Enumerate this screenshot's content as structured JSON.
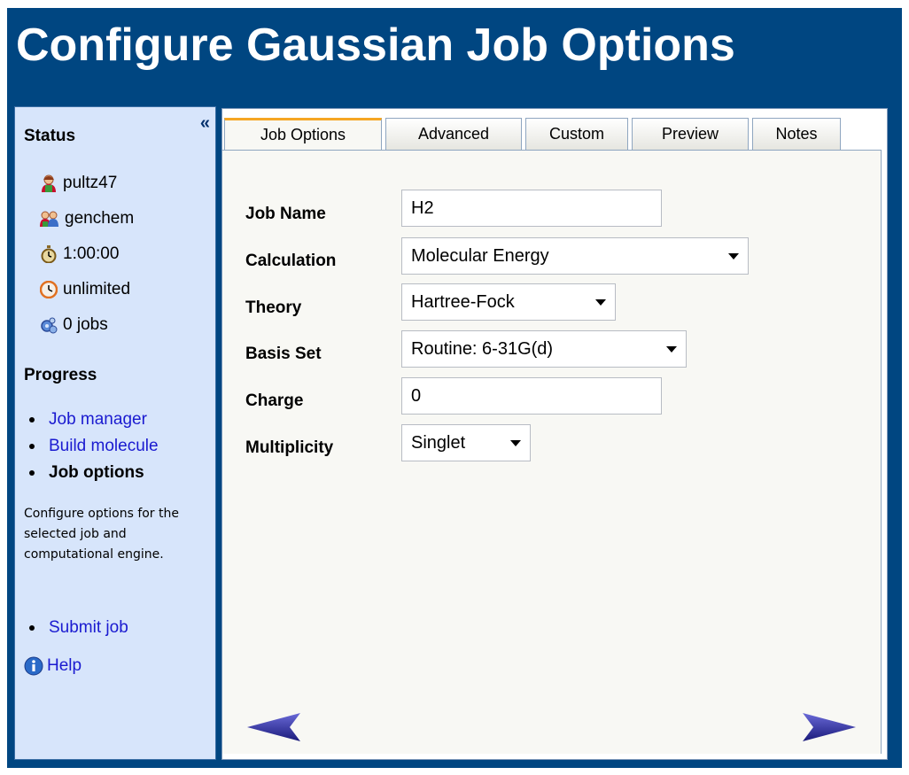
{
  "page": {
    "title": "Configure Gaussian Job Options"
  },
  "sidebar": {
    "collapse_glyph": "«",
    "status_heading": "Status",
    "status_items": [
      {
        "icon": "user-icon",
        "label": "pultz47"
      },
      {
        "icon": "group-icon",
        "label": "genchem"
      },
      {
        "icon": "stopwatch-icon",
        "label": "1:00:00"
      },
      {
        "icon": "clock-icon",
        "label": "unlimited"
      },
      {
        "icon": "gear-jobs-icon",
        "label": "0 jobs"
      }
    ],
    "progress_heading": "Progress",
    "progress_items": [
      {
        "label": "Job manager",
        "state": "link"
      },
      {
        "label": "Build molecule",
        "state": "link"
      },
      {
        "label": "Job options",
        "state": "current"
      }
    ],
    "description": "Configure options for the selected job and computational engine.",
    "next_step": "Submit job",
    "help_label": "Help"
  },
  "tabs": [
    {
      "label": "Job Options",
      "active": true
    },
    {
      "label": "Advanced",
      "active": false
    },
    {
      "label": "Custom",
      "active": false
    },
    {
      "label": "Preview",
      "active": false
    },
    {
      "label": "Notes",
      "active": false
    }
  ],
  "form": {
    "job_name": {
      "label": "Job Name",
      "value": "H2"
    },
    "calculation": {
      "label": "Calculation",
      "value": "Molecular Energy"
    },
    "theory": {
      "label": "Theory",
      "value": "Hartree-Fock"
    },
    "basis_set": {
      "label": "Basis Set",
      "value": "Routine: 6-31G(d)"
    },
    "charge": {
      "label": "Charge",
      "value": "0"
    },
    "multiplicity": {
      "label": "Multiplicity",
      "value": "Singlet"
    }
  },
  "colors": {
    "header_bg": "#004681",
    "sidebar_bg": "#d7e5fb",
    "link": "#1a1ad0",
    "active_tab_accent": "#f5a623",
    "nav_arrow": "#2a2a8c"
  }
}
